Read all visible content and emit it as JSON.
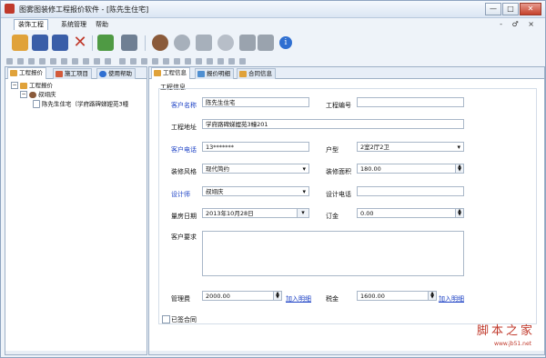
{
  "window": {
    "title": "图雾图装修工程报价软件 - [陈先生住宅]",
    "controls": [
      "—",
      "□",
      "✕"
    ]
  },
  "menubar": {
    "items": [
      "装饰工程",
      "系统管理",
      "帮助"
    ],
    "mdi_controls": "- ♂ ×"
  },
  "toolbar": {
    "icons": [
      "folder-icon",
      "save-icon",
      "save-as-icon",
      "delete-icon",
      "excel-export-icon",
      "print-icon",
      "user-icon",
      "user-gray-icon",
      "card-icon",
      "settings-icon",
      "calculator-icon",
      "info-icon"
    ]
  },
  "colors": {
    "accent": "#1a3fc4",
    "tree_line": "#9aa9bb",
    "watermark": "#c0392b"
  },
  "left_tabs": [
    "工程报价",
    "施工项目",
    "使用帮助"
  ],
  "tree": {
    "root": "工程报价",
    "child": "叔翊庆",
    "leaf": "陈先生住宅（学府路碑娣娌苑3幢"
  },
  "right_tabs": [
    "工程信息",
    "报价明细",
    "合同信息"
  ],
  "section_title": "工程信息",
  "form": {
    "customer_name_label": "客户名称",
    "customer_name": "陈先生住宅",
    "project_no_label": "工程编号",
    "project_no": "",
    "address_label": "工程地址",
    "address": "学府路碑娣娌苑3幢201",
    "phone_label": "客户电话",
    "phone": "13*******",
    "house_type_label": "户型",
    "house_type": "2室2厅2卫",
    "style_label": "装修风格",
    "style": "现代简约",
    "area_label": "装修面积",
    "area": "180.00",
    "designer_label": "设计师",
    "designer": "叔翊庆",
    "designer_phone_label": "设计电话",
    "designer_phone": "",
    "measure_date_label": "量房日期",
    "measure_date": "2013年10月28日",
    "deposit_label": "订金",
    "deposit": "0.00",
    "requirements_label": "客户要求",
    "requirements": "",
    "mgmt_fee_label": "管理费",
    "mgmt_fee": "2000.00",
    "add_detail_1": "加入明细",
    "tax_label": "税金",
    "tax": "1600.00",
    "add_detail_2": "加入明细",
    "signed_label": "已签合同"
  },
  "watermark": {
    "main": "脚本之家",
    "sub": "www.jb51.net"
  }
}
